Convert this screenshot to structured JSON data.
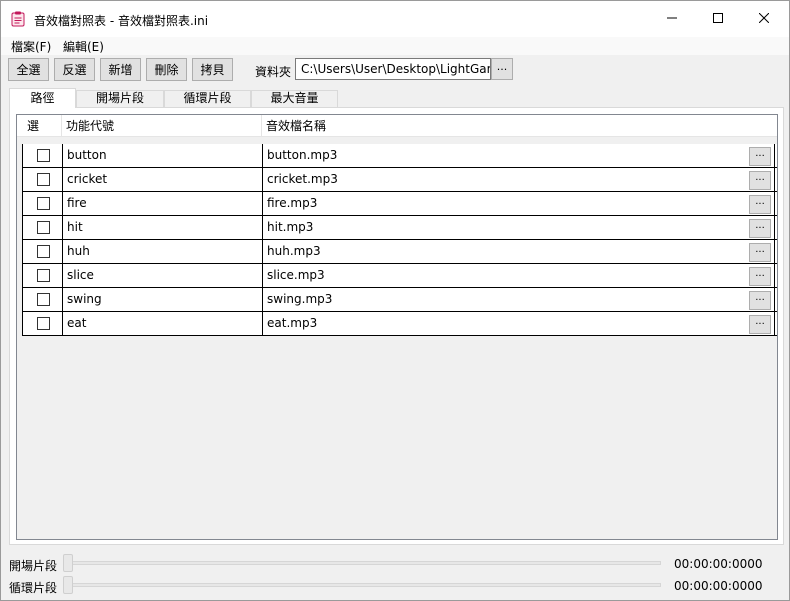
{
  "window": {
    "title": "音效檔對照表 - 音效檔對照表.ini"
  },
  "icons": {
    "app": "notepad-app-icon",
    "minimize": "minimize-icon",
    "maximize": "maximize-icon",
    "close": "close-icon"
  },
  "menu": [
    {
      "label": "檔案(F)"
    },
    {
      "label": "編輯(E)"
    }
  ],
  "toolbar": {
    "select_all": "全選",
    "invert": "反選",
    "add": "新增",
    "delete": "刪除",
    "copy": "拷貝",
    "folder_label": "資料夾",
    "folder_value": "C:\\Users\\User\\Desktop\\LightGam",
    "browse": "..."
  },
  "tabs": [
    {
      "label": "路徑",
      "active": true
    },
    {
      "label": "開場片段",
      "active": false
    },
    {
      "label": "循環片段",
      "active": false
    },
    {
      "label": "最大音量",
      "active": false
    }
  ],
  "grid": {
    "columns": [
      "選",
      "功能代號",
      "音效檔名稱"
    ],
    "row_button": "...",
    "rows": [
      {
        "checked": false,
        "code": "button",
        "file": "button.mp3"
      },
      {
        "checked": false,
        "code": "cricket",
        "file": "cricket.mp3"
      },
      {
        "checked": false,
        "code": "fire",
        "file": "fire.mp3"
      },
      {
        "checked": false,
        "code": "hit",
        "file": "hit.mp3"
      },
      {
        "checked": false,
        "code": "huh",
        "file": "huh.mp3"
      },
      {
        "checked": false,
        "code": "slice",
        "file": "slice.mp3"
      },
      {
        "checked": false,
        "code": "swing",
        "file": "swing.mp3"
      },
      {
        "checked": false,
        "code": "eat",
        "file": "eat.mp3"
      }
    ]
  },
  "sliders": [
    {
      "label": "開場片段",
      "time": "00:00:00:0000",
      "value": 0
    },
    {
      "label": "循環片段",
      "time": "00:00:00:0000",
      "value": 0
    }
  ]
}
